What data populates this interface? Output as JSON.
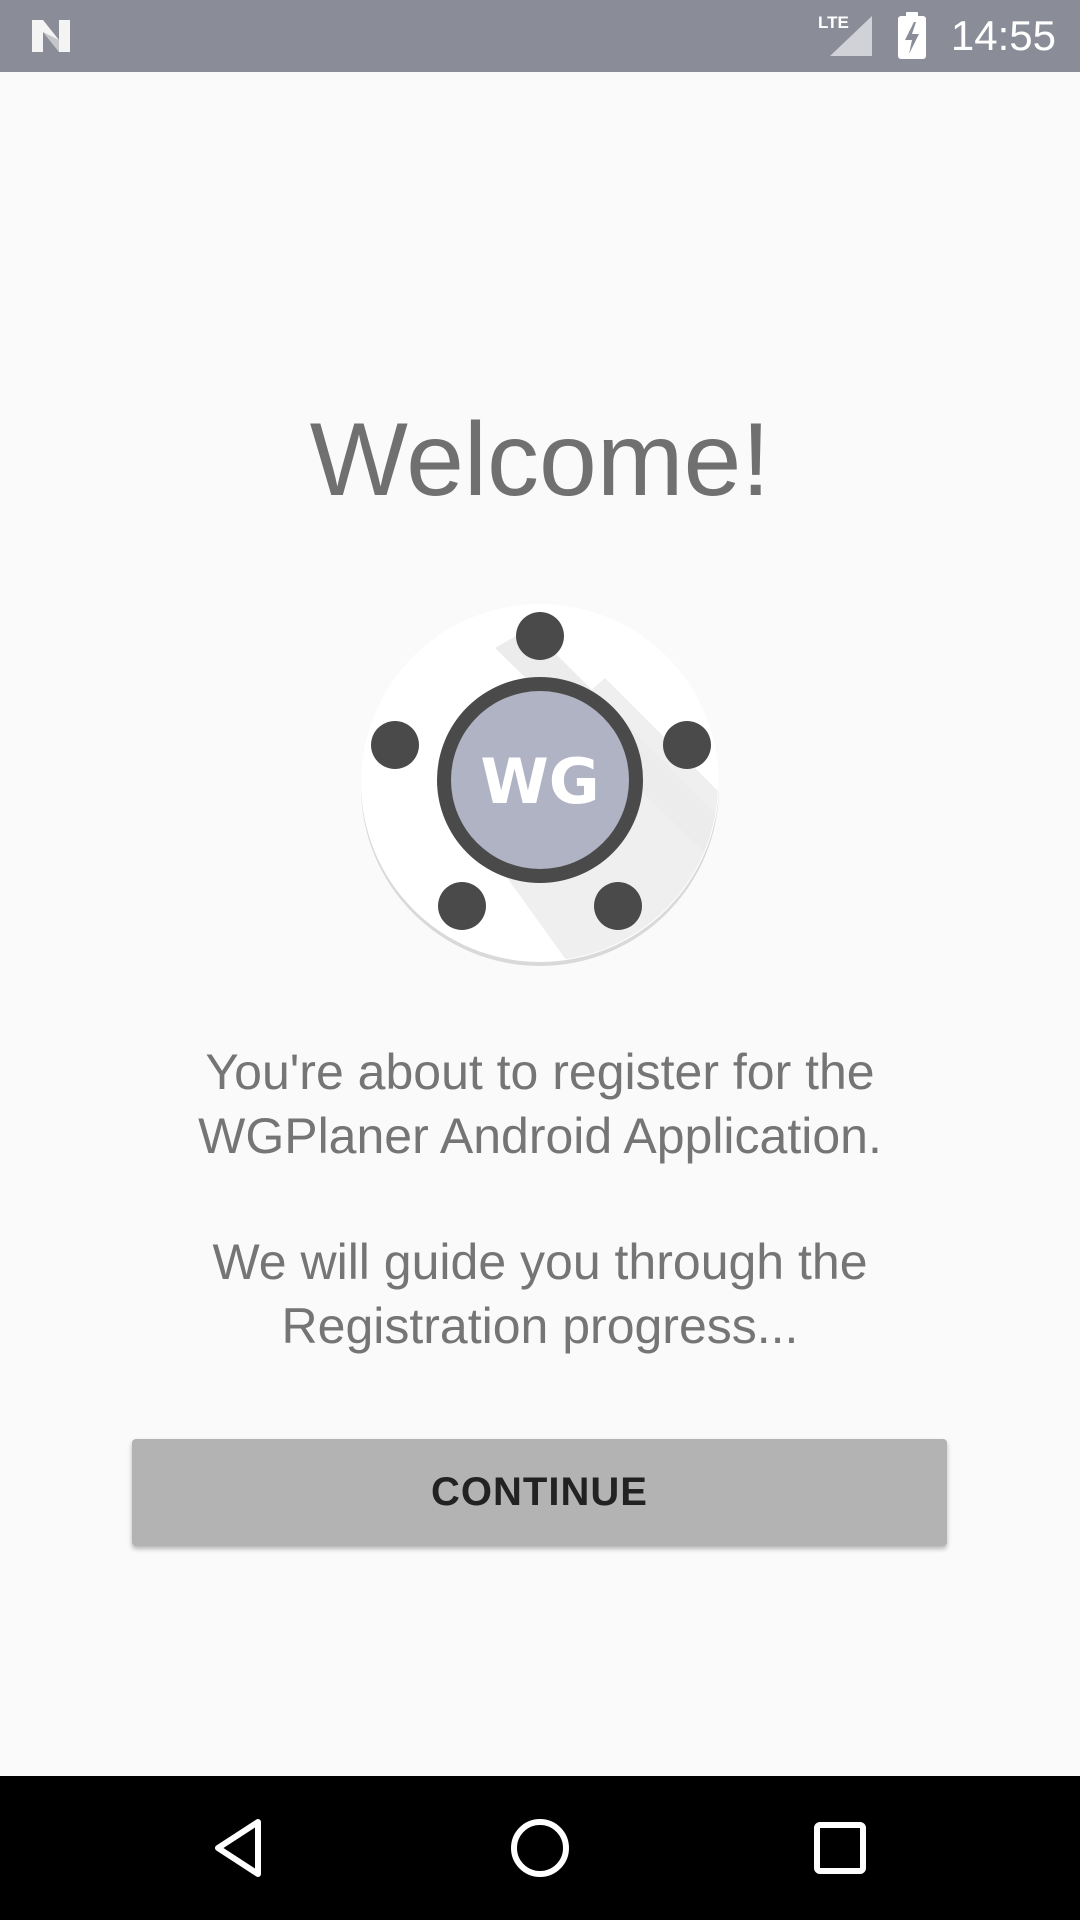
{
  "status_bar": {
    "network": "LTE",
    "time": "14:55",
    "icons": [
      "android-n-icon",
      "lte-signal-icon",
      "battery-charging-icon"
    ]
  },
  "main": {
    "title": "Welcome!",
    "logo_text": "WG",
    "intro_line_1": "You're about to register for the WGPlaner Android Application.",
    "intro_line_2": "We will guide you through the Registration progress...",
    "continue_label": "CONTINUE"
  },
  "nav_bar": {
    "icons": [
      "back-icon",
      "home-icon",
      "recents-icon"
    ]
  },
  "colors": {
    "status_bar": "#8a8d97",
    "background": "#fafafa",
    "button": "#b3b3b3",
    "text": "#757575",
    "logo_center": "#b0b3c4",
    "logo_ring": "#4a4a4a"
  }
}
